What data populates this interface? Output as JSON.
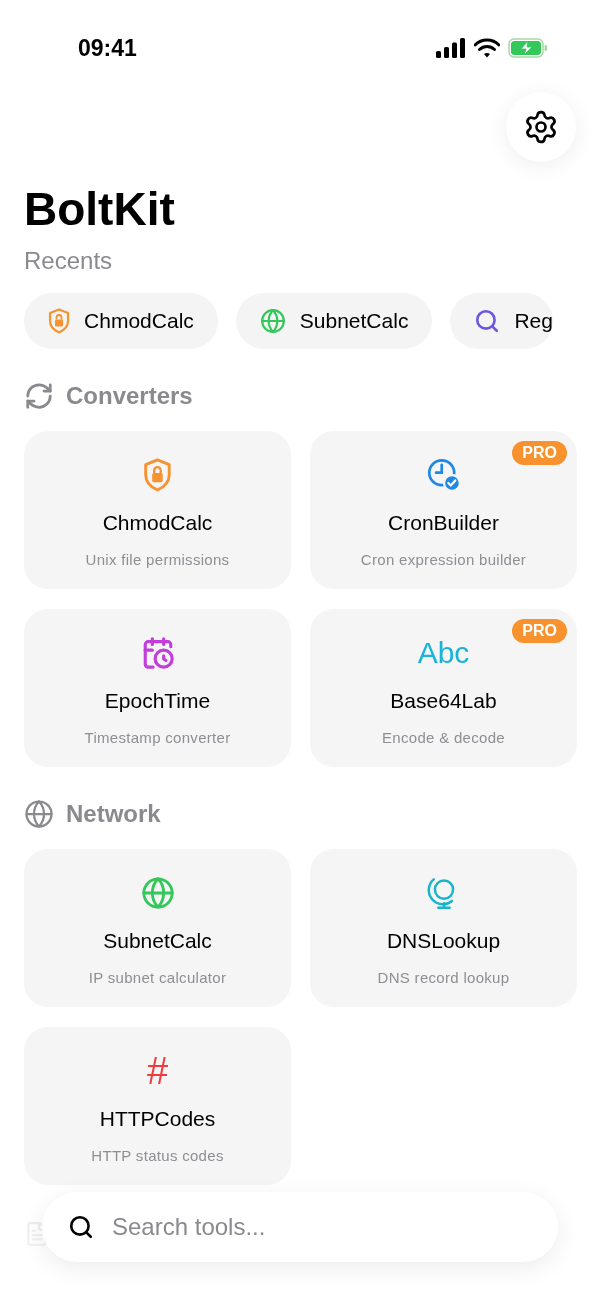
{
  "status_bar": {
    "time": "09:41"
  },
  "title": "BoltKit",
  "recents": {
    "heading": "Recents",
    "items": [
      {
        "label": "ChmodCalc",
        "kind": "shield",
        "color": "#f59331"
      },
      {
        "label": "SubnetCalc",
        "kind": "globe",
        "color": "#34c759"
      },
      {
        "label": "Reg",
        "kind": "search",
        "color": "#6e56e0"
      }
    ]
  },
  "sections": [
    {
      "heading": "Converters",
      "kind": "refresh",
      "tools": [
        {
          "name": "ChmodCalc",
          "subtitle": "Unix file permissions",
          "kind": "shield",
          "color": "#f59331"
        },
        {
          "name": "CronBuilder",
          "subtitle": "Cron expression builder",
          "kind": "clock",
          "color": "#1e88e5",
          "badge": "PRO"
        },
        {
          "name": "EpochTime",
          "subtitle": "Timestamp converter",
          "kind": "calendar",
          "color": "#c23ddb"
        },
        {
          "name": "Base64Lab",
          "subtitle": "Encode & decode",
          "kind": "glyph",
          "glyph": "Abc",
          "color": "#18b4dc",
          "badge": "PRO"
        }
      ]
    },
    {
      "heading": "Network",
      "kind": "globe",
      "tools": [
        {
          "name": "SubnetCalc",
          "subtitle": "IP subnet calculator",
          "kind": "globe",
          "color": "#34c759"
        },
        {
          "name": "DNSLookup",
          "subtitle": "DNS record lookup",
          "kind": "stand",
          "color": "#18b4cc"
        },
        {
          "name": "HTTPCodes",
          "subtitle": "HTTP status codes",
          "kind": "glyph",
          "glyph": "#",
          "color": "#ee3b3b"
        }
      ]
    }
  ],
  "search": {
    "placeholder": "Search tools..."
  }
}
